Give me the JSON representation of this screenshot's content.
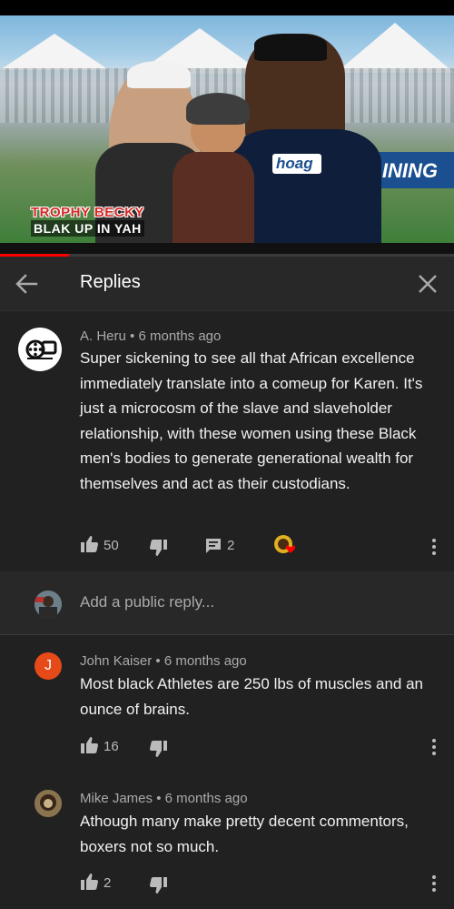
{
  "video": {
    "overlay_line1": "TROPHY BECKY",
    "overlay_line2": "BLAK UP IN YAH",
    "jersey_text": "hoag",
    "banner_text": "AINING",
    "progress_fraction": 0.15
  },
  "header": {
    "back_icon": "arrow-left-icon",
    "title": "Replies",
    "close_icon": "close-icon"
  },
  "parent_comment": {
    "author": "A. Heru",
    "separator": "•",
    "time": "6 months ago",
    "text": "Super sickening to see all that African excellence immediately translate into a comeup for Karen. It's just a microcosm of the slave and slaveholder relationship, with these women using these Black men's bodies to generate generational wealth for themselves and act as their custodians.",
    "likes": "50",
    "replies": "2"
  },
  "reply_box": {
    "placeholder": "Add a public reply..."
  },
  "replies": [
    {
      "avatar_letter": "J",
      "avatar_color": "#e64a19",
      "author": "John Kaiser",
      "time": "6 months ago",
      "text": "Most black Athletes are 250 lbs of muscles and an ounce of brains.",
      "likes": "16"
    },
    {
      "avatar_letter": "",
      "avatar_color": "#6d5a3a",
      "author": "Mike James",
      "time": "6 months ago",
      "text": "Athough many make pretty decent commentors, boxers not so much.",
      "likes": "2"
    }
  ],
  "colors": {
    "background": "#212121",
    "header_bg": "#282828",
    "progress": "#ff0000",
    "heart": "#ff0000"
  }
}
